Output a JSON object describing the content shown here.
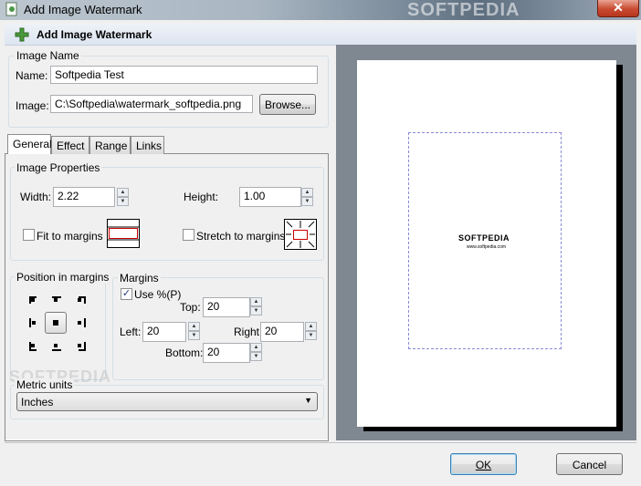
{
  "window": {
    "title": "Add Image Watermark",
    "close_glyph": "✕",
    "watermark_text": "SOFTPEDIA"
  },
  "header": {
    "title": "Add Image Watermark",
    "icon": "add-watermark-icon"
  },
  "image_name_group": {
    "label": "Image Name",
    "name_label": "Name:",
    "name_value": "Softpedia Test",
    "image_label": "Image:",
    "image_value": "C:\\Softpedia\\watermark_softpedia.png",
    "browse_label": "Browse..."
  },
  "tabs": [
    "General",
    "Effect",
    "Range",
    "Links"
  ],
  "image_properties": {
    "label": "Image Properties",
    "width_label": "Width:",
    "width_value": "2.22",
    "height_label": "Height:",
    "height_value": "1.00",
    "fit_label": "Fit to margins",
    "fit_checked": false,
    "stretch_label": "Stretch to margins",
    "stretch_checked": false
  },
  "position": {
    "label": "Position in margins",
    "selected": "center"
  },
  "margins": {
    "label": "Margins",
    "use_percent_label": "Use %(P)",
    "use_percent_checked": true,
    "top_label": "Top:",
    "top_value": "20",
    "left_label": "Left:",
    "left_value": "20",
    "right_label": "Right:",
    "right_value": "20",
    "bottom_label": "Bottom:",
    "bottom_value": "20"
  },
  "metric_units": {
    "label": "Metric units",
    "selected": "Inches"
  },
  "preview": {
    "logo_text": "SOFTPEDIA",
    "logo_sub": "www.softpedia.com"
  },
  "buttons": {
    "ok": "OK",
    "cancel": "Cancel"
  },
  "colors": {
    "preview_bg": "#7f8791",
    "dashed_border": "#8a8ad8",
    "accent": "#3c7fb1"
  }
}
